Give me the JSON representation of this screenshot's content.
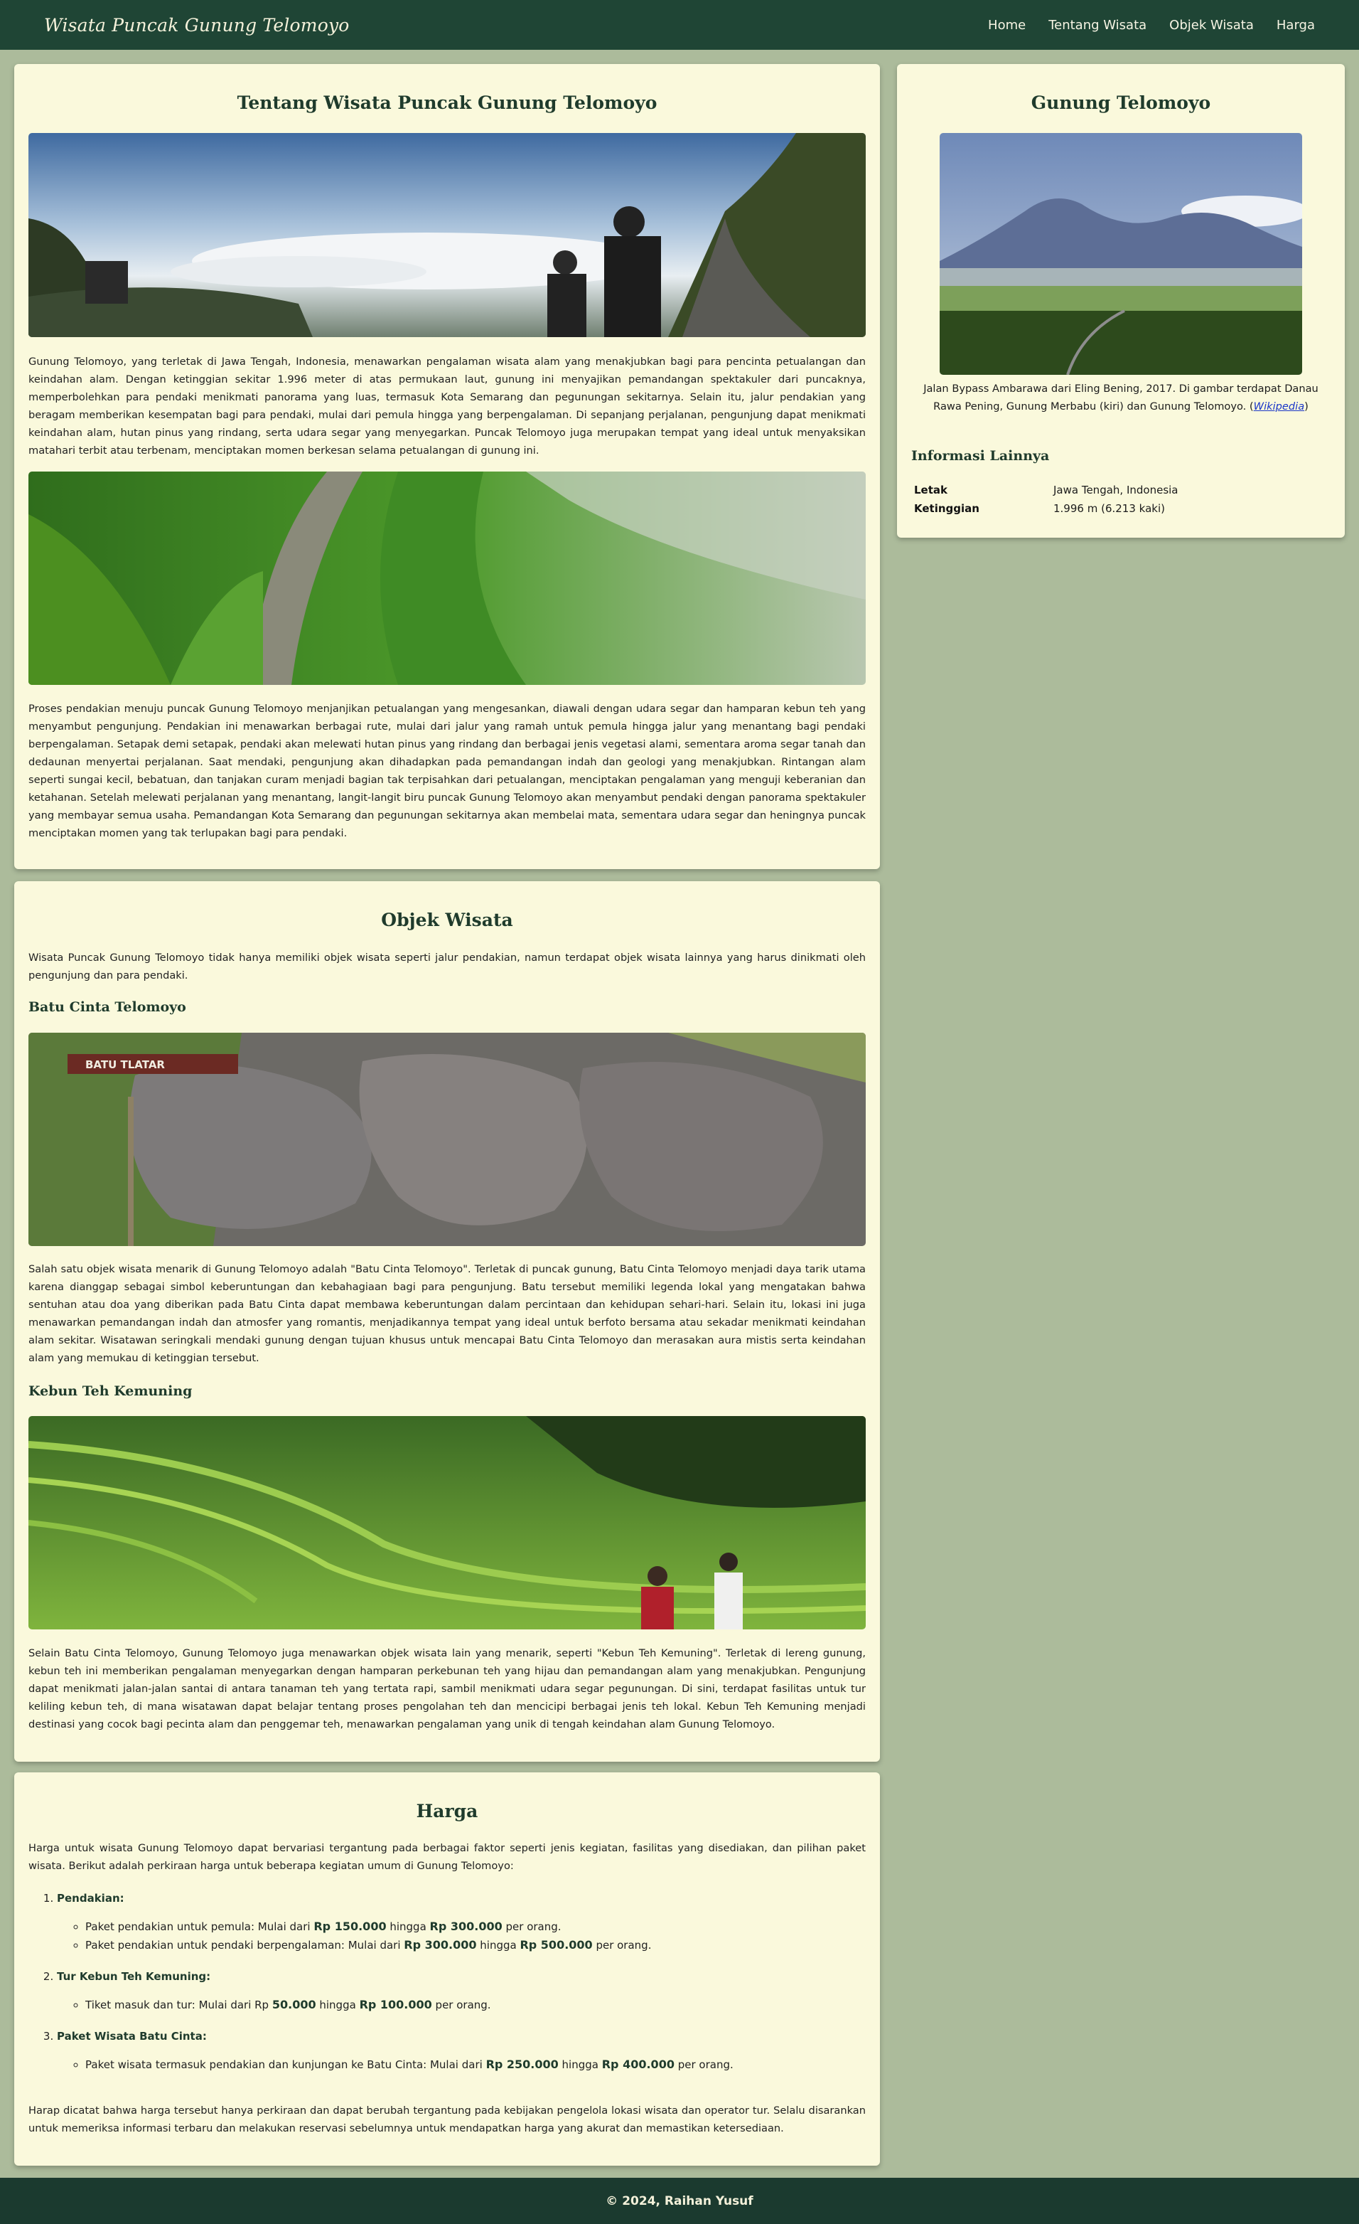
{
  "header": {
    "brand": "Wisata Puncak Gunung Telomoyo",
    "nav": [
      "Home",
      "Tentang Wisata",
      "Objek Wisata",
      "Harga"
    ]
  },
  "about": {
    "title": "Tentang Wisata Puncak Gunung Telomoyo",
    "p1": "Gunung Telomoyo, yang terletak di Jawa Tengah, Indonesia, menawarkan pengalaman wisata alam yang menakjubkan bagi para pencinta petualangan dan keindahan alam. Dengan ketinggian sekitar 1.996 meter di atas permukaan laut, gunung ini menyajikan pemandangan spektakuler dari puncaknya, memperbolehkan para pendaki menikmati panorama yang luas, termasuk Kota Semarang dan pegunungan sekitarnya. Selain itu, jalur pendakian yang beragam memberikan kesempatan bagi para pendaki, mulai dari pemula hingga yang berpengalaman. Di sepanjang perjalanan, pengunjung dapat menikmati keindahan alam, hutan pinus yang rindang, serta udara segar yang menyegarkan. Puncak Telomoyo juga merupakan tempat yang ideal untuk menyaksikan matahari terbit atau terbenam, menciptakan momen berkesan selama petualangan di gunung ini.",
    "p2": "Proses pendakian menuju puncak Gunung Telomoyo menjanjikan petualangan yang mengesankan, diawali dengan udara segar dan hamparan kebun teh yang menyambut pengunjung. Pendakian ini menawarkan berbagai rute, mulai dari jalur yang ramah untuk pemula hingga jalur yang menantang bagi pendaki berpengalaman. Setapak demi setapak, pendaki akan melewati hutan pinus yang rindang dan berbagai jenis vegetasi alami, sementara aroma segar tanah dan dedaunan menyertai perjalanan. Saat mendaki, pengunjung akan dihadapkan pada pemandangan indah dan geologi yang menakjubkan. Rintangan alam seperti sungai kecil, bebatuan, dan tanjakan curam menjadi bagian tak terpisahkan dari petualangan, menciptakan pengalaman yang menguji keberanian dan ketahanan. Setelah melewati perjalanan yang menantang, langit-langit biru puncak Gunung Telomoyo akan menyambut pendaki dengan panorama spektakuler yang membayar semua usaha. Pemandangan Kota Semarang dan pegunungan sekitarnya akan membelai mata, sementara udara segar dan heningnya puncak menciptakan momen yang tak terlupakan bagi para pendaki."
  },
  "sidebar": {
    "title": "Gunung Telomoyo",
    "caption": "Jalan Bypass Ambarawa dari Eling Bening, 2017. Di gambar terdapat Danau Rawa Pening, Gunung Merbabu (kiri) dan Gunung Telomoyo.",
    "caption_link": "Wikipedia",
    "info_title": "Informasi Lainnya",
    "rows": [
      {
        "k": "Letak",
        "v": "Jawa Tengah, Indonesia"
      },
      {
        "k": "Ketinggian",
        "v": "1.996 m (6.213 kaki)"
      }
    ]
  },
  "objek": {
    "title": "Objek Wisata",
    "intro": "Wisata Puncak Gunung Telomoyo tidak hanya memiliki objek wisata seperti jalur pendakian, namun terdapat objek wisata lainnya yang harus dinikmati oleh pengunjung dan para pendaki.",
    "batu_title": "Batu Cinta Telomoyo",
    "batu_sign": "BATU TLATAR",
    "batu_text": "Salah satu objek wisata menarik di Gunung Telomoyo adalah \"Batu Cinta Telomoyo\". Terletak di puncak gunung, Batu Cinta Telomoyo menjadi daya tarik utama karena dianggap sebagai simbol keberuntungan dan kebahagiaan bagi para pengunjung. Batu tersebut memiliki legenda lokal yang mengatakan bahwa sentuhan atau doa yang diberikan pada Batu Cinta dapat membawa keberuntungan dalam percintaan dan kehidupan sehari-hari. Selain itu, lokasi ini juga menawarkan pemandangan indah dan atmosfer yang romantis, menjadikannya tempat yang ideal untuk berfoto bersama atau sekadar menikmati keindahan alam sekitar. Wisatawan seringkali mendaki gunung dengan tujuan khusus untuk mencapai Batu Cinta Telomoyo dan merasakan aura mistis serta keindahan alam yang memukau di ketinggian tersebut.",
    "kebun_title": "Kebun Teh Kemuning",
    "kebun_text": "Selain Batu Cinta Telomoyo, Gunung Telomoyo juga menawarkan objek wisata lain yang menarik, seperti \"Kebun Teh Kemuning\". Terletak di lereng gunung, kebun teh ini memberikan pengalaman menyegarkan dengan hamparan perkebunan teh yang hijau dan pemandangan alam yang menakjubkan. Pengunjung dapat menikmati jalan-jalan santai di antara tanaman teh yang tertata rapi, sambil menikmati udara segar pegunungan. Di sini, terdapat fasilitas untuk tur keliling kebun teh, di mana wisatawan dapat belajar tentang proses pengolahan teh dan mencicipi berbagai jenis teh lokal. Kebun Teh Kemuning menjadi destinasi yang cocok bagi pecinta alam dan penggemar teh, menawarkan pengalaman yang unik di tengah keindahan alam Gunung Telomoyo."
  },
  "harga": {
    "title": "Harga",
    "intro": "Harga untuk wisata Gunung Telomoyo dapat bervariasi tergantung pada berbagai faktor seperti jenis kegiatan, fasilitas yang disediakan, dan pilihan paket wisata. Berikut adalah perkiraan harga untuk beberapa kegiatan umum di Gunung Telomoyo:",
    "cats": [
      {
        "name": "Pendakian:",
        "items": [
          {
            "pre": "Paket pendakian untuk pemula: Mulai dari ",
            "a": "Rp 150.000",
            "mid": " hingga ",
            "b": "Rp 300.000",
            "post": " per orang."
          },
          {
            "pre": "Paket pendakian untuk pendaki berpengalaman: Mulai dari ",
            "a": "Rp 300.000",
            "mid": " hingga ",
            "b": "Rp 500.000",
            "post": " per orang."
          }
        ]
      },
      {
        "name": "Tur Kebun Teh Kemuning:",
        "items": [
          {
            "pre": "Tiket masuk dan tur: Mulai dari Rp ",
            "a": "50.000",
            "mid": " hingga ",
            "b": "Rp 100.000",
            "post": " per orang."
          }
        ]
      },
      {
        "name": "Paket Wisata Batu Cinta:",
        "items": [
          {
            "pre": "Paket wisata termasuk pendakian dan kunjungan ke Batu Cinta: Mulai dari ",
            "a": "Rp 250.000",
            "mid": " hingga ",
            "b": "Rp 400.000",
            "post": " per orang."
          }
        ]
      }
    ],
    "note": "Harap dicatat bahwa harga tersebut hanya perkiraan dan dapat berubah tergantung pada kebijakan pengelola lokasi wisata dan operator tur. Selalu disarankan untuk memeriksa informasi terbaru dan melakukan reservasi sebelumnya untuk mendapatkan harga yang akurat dan memastikan ketersediaan."
  },
  "footer": {
    "text": "© 2024, Raihan Yusuf"
  },
  "colors": {
    "header_bg": "#1f4535",
    "page_bg": "#acbb9b",
    "card_bg": "#faf9dc",
    "heading": "#1f3b2c",
    "footer_bg": "#1b3a2f"
  }
}
